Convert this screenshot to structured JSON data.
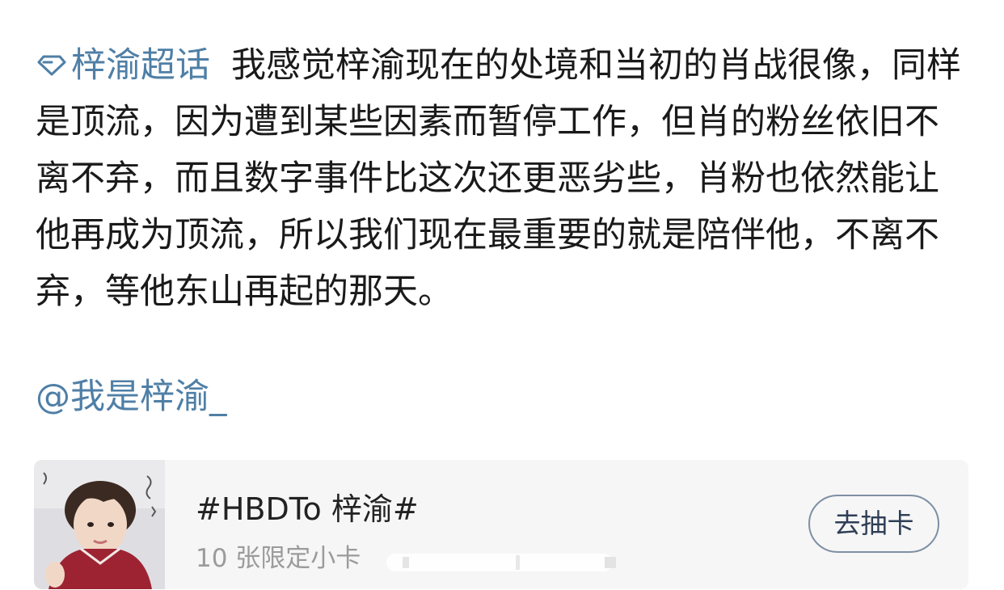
{
  "post": {
    "topic_tag": "梓渝超话",
    "body_text": "我感觉梓渝现在的处境和当初的肖战很像，同样是顶流，因为遭到某些因素而暂停工作，但肖的粉丝依旧不离不弃，而且数字事件比这次还更恶劣些，肖粉也依然能让他再成为顶流，所以我们现在最重要的就是陪伴他，不离不弃，等他东山再起的那天。",
    "mention": "@我是梓渝_"
  },
  "card": {
    "title": "#HBDTo 梓渝#",
    "subtitle": "10 张限定小卡",
    "button_label": "去抽卡"
  },
  "colors": {
    "link": "#4f7fa6",
    "text": "#1a1a1a",
    "card_bg": "#f6f6f6",
    "button_border": "#7f8fa4"
  },
  "icons": {
    "topic": "diamond-icon"
  }
}
